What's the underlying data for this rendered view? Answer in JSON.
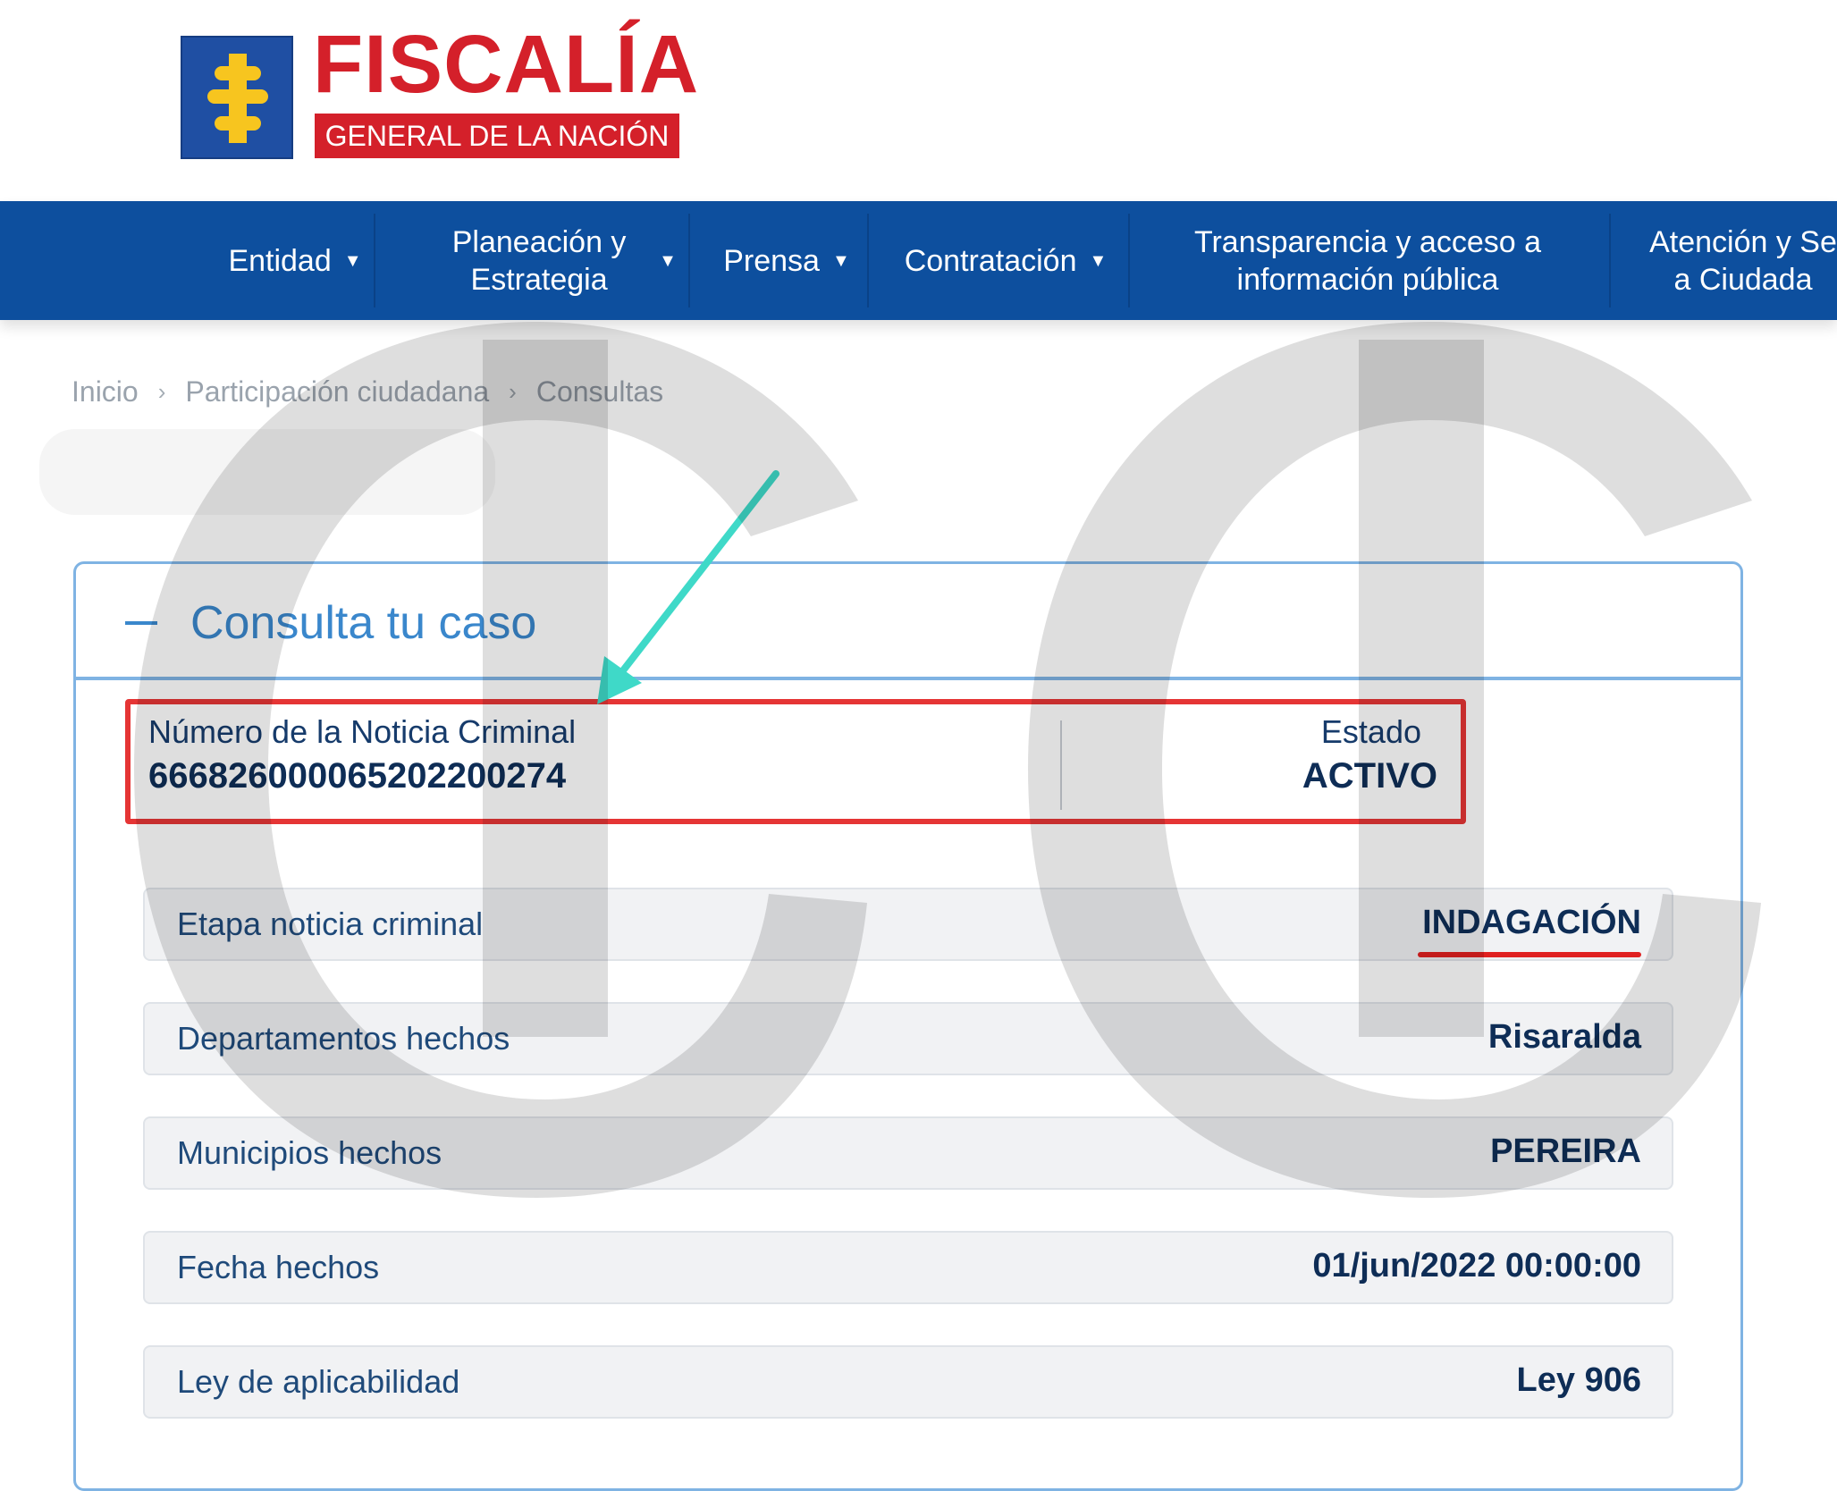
{
  "logo": {
    "title": "FISCALÍA",
    "subtitle": "GENERAL DE LA NACIÓN"
  },
  "nav": {
    "items": [
      {
        "label": "Entidad",
        "has_dropdown": true
      },
      {
        "label": "Planeación y Estrategia",
        "has_dropdown": true
      },
      {
        "label": "Prensa",
        "has_dropdown": true
      },
      {
        "label": "Contratación",
        "has_dropdown": true
      },
      {
        "label": "Transparencia y acceso a información pública",
        "has_dropdown": false
      },
      {
        "label": "Atención y Se a Ciudada",
        "has_dropdown": false
      }
    ]
  },
  "breadcrumb": [
    "Inicio",
    "Participación ciudadana",
    "Consultas"
  ],
  "panel": {
    "title": "Consulta tu caso",
    "case_number_label": "Número de la Noticia Criminal",
    "case_number": "666826000065202200274",
    "status_label": "Estado",
    "status": "ACTIVO",
    "rows": [
      {
        "label": "Etapa noticia criminal",
        "value": "INDAGACIÓN"
      },
      {
        "label": "Departamentos hechos",
        "value": "Risaralda"
      },
      {
        "label": "Municipios hechos",
        "value": "PEREIRA"
      },
      {
        "label": "Fecha hechos",
        "value": "01/jun/2022 00:00:00"
      },
      {
        "label": "Ley de aplicabilidad",
        "value": "Ley 906"
      }
    ]
  },
  "colors": {
    "brand_red": "#d4202a",
    "nav_blue": "#0d4f9e",
    "panel_border": "#7fb3e3",
    "highlight_red": "#e53535",
    "arrow_teal": "#3fd9c8"
  }
}
